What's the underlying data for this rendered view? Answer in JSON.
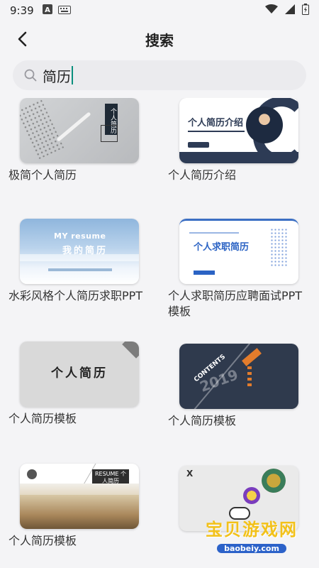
{
  "status_bar": {
    "time": "9:39"
  },
  "header": {
    "title": "搜索"
  },
  "search": {
    "query": "简历"
  },
  "results": [
    {
      "title": "极简个人简历",
      "thumb_text": "个人简历"
    },
    {
      "title": "个人简历介绍",
      "thumb_text": "个人简历介绍"
    },
    {
      "title": "水彩风格个人简历求职PPT",
      "thumb_text_1": "MY resume",
      "thumb_text_2": "我的简历"
    },
    {
      "title": "个人求职简历应聘面试PPT模板",
      "thumb_text": "个人求职简历"
    },
    {
      "title": "个人简历模板",
      "thumb_text": "个人简历"
    },
    {
      "title": "个人简历模板",
      "thumb_text_1": "CONTENTS",
      "thumb_text_2": "2019"
    },
    {
      "title": "个人简历模板",
      "thumb_text": "RESUME 个人简历"
    },
    {
      "title": "",
      "thumb_text": "X"
    }
  ],
  "watermark": {
    "text": "宝贝游戏网",
    "url": "baobeiy.com"
  }
}
